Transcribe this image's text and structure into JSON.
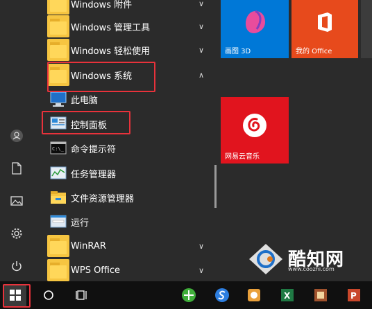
{
  "start_menu": {
    "app_list": [
      {
        "label": "Windows 附件",
        "icon": "folder-icon",
        "expanded": false
      },
      {
        "label": "Windows 管理工具",
        "icon": "folder-icon",
        "expanded": false
      },
      {
        "label": "Windows 轻松使用",
        "icon": "folder-icon",
        "expanded": false
      },
      {
        "label": "Windows 系统",
        "icon": "folder-icon",
        "expanded": true
      },
      {
        "label": "此电脑",
        "icon": "this-pc-icon"
      },
      {
        "label": "控制面板",
        "icon": "control-panel-icon"
      },
      {
        "label": "命令提示符",
        "icon": "command-prompt-icon"
      },
      {
        "label": "任务管理器",
        "icon": "task-manager-icon"
      },
      {
        "label": "文件资源管理器",
        "icon": "file-explorer-icon"
      },
      {
        "label": "运行",
        "icon": "run-icon"
      },
      {
        "label": "WinRAR",
        "icon": "folder-icon",
        "expanded": false
      },
      {
        "label": "WPS Office",
        "icon": "folder-icon",
        "expanded": false
      }
    ],
    "tiles": [
      {
        "label": "画图 3D",
        "icon": "paint-3d-icon",
        "color": "#0078d7"
      },
      {
        "label": "我的 Office",
        "icon": "office-icon",
        "color": "#e74a1c"
      },
      {
        "label": "网易云音乐",
        "icon": "netease-music-icon",
        "color": "#e1141e"
      }
    ],
    "rail_icons": [
      "user-icon",
      "document-icon",
      "pictures-icon",
      "settings-icon",
      "power-icon"
    ]
  },
  "taskbar": {
    "icons": [
      "windows-start-icon",
      "cortana-icon",
      "task-view-icon",
      "app-icon-green",
      "sogou-browser-icon",
      "app-icon-orange",
      "excel-icon",
      "app-icon-brown",
      "powerpoint-icon"
    ]
  },
  "watermark": {
    "text": "酷知网",
    "url": "www.coozhi.com"
  },
  "colors": {
    "highlight": "#e8323b",
    "background": "#2b2b2b"
  }
}
